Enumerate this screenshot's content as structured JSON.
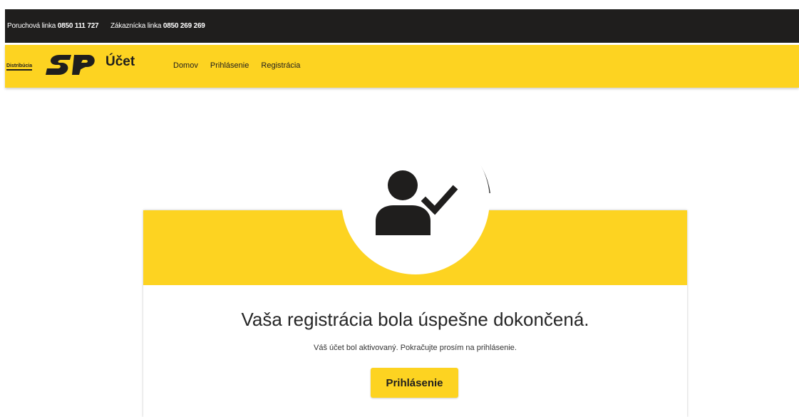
{
  "topbar": {
    "fault_label": "Poruchová linka",
    "fault_number": "0850 111 727",
    "customer_label": "Zákaznícka linka",
    "customer_number": "0850 269 269"
  },
  "navbar": {
    "logo_sub": "Distribúcia",
    "logo_brand": "SPP",
    "account_label": "Účet",
    "links": [
      {
        "label": "Domov"
      },
      {
        "label": "Prihlásenie"
      },
      {
        "label": "Registrácia"
      }
    ]
  },
  "icons": {
    "user_check": "user-check-icon"
  },
  "content": {
    "title": "Vaša registrácia bola úspešne dokončená.",
    "message": "Váš účet bol aktivovaný. Pokračujte prosím na prihlásenie.",
    "login_button": "Prihlásenie"
  },
  "colors": {
    "brand_yellow": "#fdd321",
    "dark": "#1f1e1d"
  }
}
